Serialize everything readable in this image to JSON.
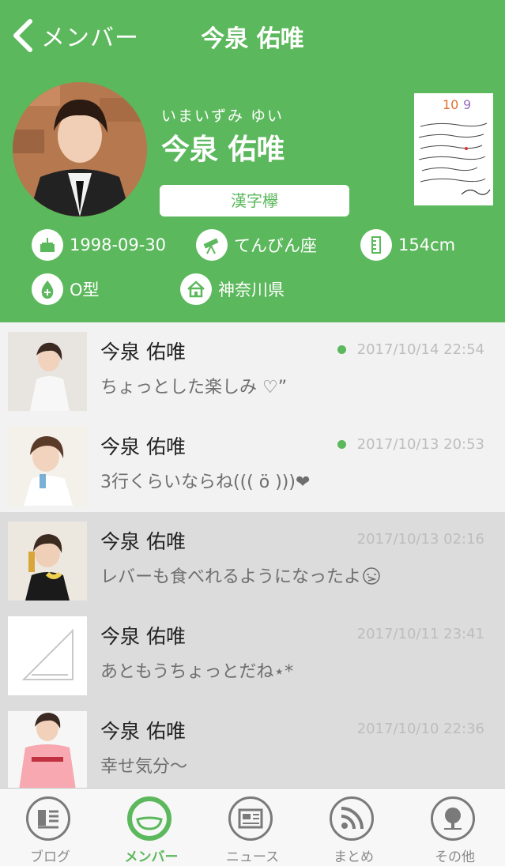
{
  "nav": {
    "back_label": "メンバー",
    "title": "今泉 佑唯"
  },
  "profile": {
    "kana": "いまいずみ ゆい",
    "name": "今泉 佑唯",
    "team": "漢字欅",
    "birthday": "1998-09-30",
    "zodiac": "てんびん座",
    "height": "154cm",
    "blood": "O型",
    "hometown": "神奈川県"
  },
  "posts": [
    {
      "author": "今泉 佑唯",
      "date": "2017/10/14 22:54",
      "snippet": "ちょっとした楽しみ ♡”",
      "unread": true
    },
    {
      "author": "今泉 佑唯",
      "date": "2017/10/13 20:53",
      "snippet": "3行くらいならね((( ö )))❤",
      "unread": true
    },
    {
      "author": "今泉 佑唯",
      "date": "2017/10/13 02:16",
      "snippet": "レバーも食べれるようになったよ",
      "unread": false
    },
    {
      "author": "今泉 佑唯",
      "date": "2017/10/11 23:41",
      "snippet": "あともうちょっとだね⋆*",
      "unread": false
    },
    {
      "author": "今泉 佑唯",
      "date": "2017/10/10 22:36",
      "snippet": "幸せ気分〜",
      "unread": false
    }
  ],
  "tabs": [
    {
      "label": "ブログ",
      "icon": "blog-icon"
    },
    {
      "label": "メンバー",
      "icon": "member-icon"
    },
    {
      "label": "ニュース",
      "icon": "news-icon"
    },
    {
      "label": "まとめ",
      "icon": "rss-icon"
    },
    {
      "label": "その他",
      "icon": "tree-icon"
    }
  ],
  "colors": {
    "accent": "#5cb85c",
    "read_row": "#dcdcdc",
    "unread_row": "#f2f2f2"
  }
}
